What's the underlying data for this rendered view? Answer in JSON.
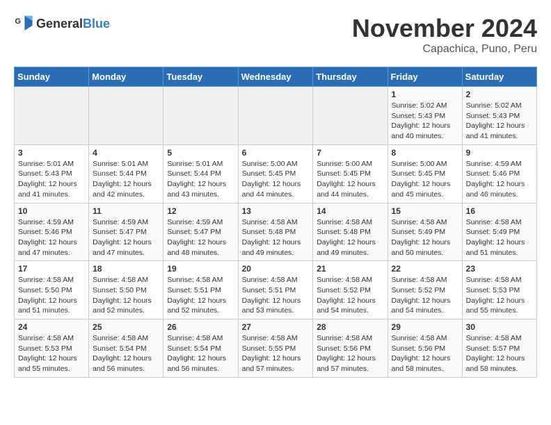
{
  "header": {
    "logo_general": "General",
    "logo_blue": "Blue",
    "month_title": "November 2024",
    "location": "Capachica, Puno, Peru"
  },
  "days_of_week": [
    "Sunday",
    "Monday",
    "Tuesday",
    "Wednesday",
    "Thursday",
    "Friday",
    "Saturday"
  ],
  "weeks": [
    [
      {
        "day": "",
        "info": ""
      },
      {
        "day": "",
        "info": ""
      },
      {
        "day": "",
        "info": ""
      },
      {
        "day": "",
        "info": ""
      },
      {
        "day": "",
        "info": ""
      },
      {
        "day": "1",
        "info": "Sunrise: 5:02 AM\nSunset: 5:43 PM\nDaylight: 12 hours and 40 minutes."
      },
      {
        "day": "2",
        "info": "Sunrise: 5:02 AM\nSunset: 5:43 PM\nDaylight: 12 hours and 41 minutes."
      }
    ],
    [
      {
        "day": "3",
        "info": "Sunrise: 5:01 AM\nSunset: 5:43 PM\nDaylight: 12 hours and 41 minutes."
      },
      {
        "day": "4",
        "info": "Sunrise: 5:01 AM\nSunset: 5:44 PM\nDaylight: 12 hours and 42 minutes."
      },
      {
        "day": "5",
        "info": "Sunrise: 5:01 AM\nSunset: 5:44 PM\nDaylight: 12 hours and 43 minutes."
      },
      {
        "day": "6",
        "info": "Sunrise: 5:00 AM\nSunset: 5:45 PM\nDaylight: 12 hours and 44 minutes."
      },
      {
        "day": "7",
        "info": "Sunrise: 5:00 AM\nSunset: 5:45 PM\nDaylight: 12 hours and 44 minutes."
      },
      {
        "day": "8",
        "info": "Sunrise: 5:00 AM\nSunset: 5:45 PM\nDaylight: 12 hours and 45 minutes."
      },
      {
        "day": "9",
        "info": "Sunrise: 4:59 AM\nSunset: 5:46 PM\nDaylight: 12 hours and 46 minutes."
      }
    ],
    [
      {
        "day": "10",
        "info": "Sunrise: 4:59 AM\nSunset: 5:46 PM\nDaylight: 12 hours and 47 minutes."
      },
      {
        "day": "11",
        "info": "Sunrise: 4:59 AM\nSunset: 5:47 PM\nDaylight: 12 hours and 47 minutes."
      },
      {
        "day": "12",
        "info": "Sunrise: 4:59 AM\nSunset: 5:47 PM\nDaylight: 12 hours and 48 minutes."
      },
      {
        "day": "13",
        "info": "Sunrise: 4:58 AM\nSunset: 5:48 PM\nDaylight: 12 hours and 49 minutes."
      },
      {
        "day": "14",
        "info": "Sunrise: 4:58 AM\nSunset: 5:48 PM\nDaylight: 12 hours and 49 minutes."
      },
      {
        "day": "15",
        "info": "Sunrise: 4:58 AM\nSunset: 5:49 PM\nDaylight: 12 hours and 50 minutes."
      },
      {
        "day": "16",
        "info": "Sunrise: 4:58 AM\nSunset: 5:49 PM\nDaylight: 12 hours and 51 minutes."
      }
    ],
    [
      {
        "day": "17",
        "info": "Sunrise: 4:58 AM\nSunset: 5:50 PM\nDaylight: 12 hours and 51 minutes."
      },
      {
        "day": "18",
        "info": "Sunrise: 4:58 AM\nSunset: 5:50 PM\nDaylight: 12 hours and 52 minutes."
      },
      {
        "day": "19",
        "info": "Sunrise: 4:58 AM\nSunset: 5:51 PM\nDaylight: 12 hours and 52 minutes."
      },
      {
        "day": "20",
        "info": "Sunrise: 4:58 AM\nSunset: 5:51 PM\nDaylight: 12 hours and 53 minutes."
      },
      {
        "day": "21",
        "info": "Sunrise: 4:58 AM\nSunset: 5:52 PM\nDaylight: 12 hours and 54 minutes."
      },
      {
        "day": "22",
        "info": "Sunrise: 4:58 AM\nSunset: 5:52 PM\nDaylight: 12 hours and 54 minutes."
      },
      {
        "day": "23",
        "info": "Sunrise: 4:58 AM\nSunset: 5:53 PM\nDaylight: 12 hours and 55 minutes."
      }
    ],
    [
      {
        "day": "24",
        "info": "Sunrise: 4:58 AM\nSunset: 5:53 PM\nDaylight: 12 hours and 55 minutes."
      },
      {
        "day": "25",
        "info": "Sunrise: 4:58 AM\nSunset: 5:54 PM\nDaylight: 12 hours and 56 minutes."
      },
      {
        "day": "26",
        "info": "Sunrise: 4:58 AM\nSunset: 5:54 PM\nDaylight: 12 hours and 56 minutes."
      },
      {
        "day": "27",
        "info": "Sunrise: 4:58 AM\nSunset: 5:55 PM\nDaylight: 12 hours and 57 minutes."
      },
      {
        "day": "28",
        "info": "Sunrise: 4:58 AM\nSunset: 5:56 PM\nDaylight: 12 hours and 57 minutes."
      },
      {
        "day": "29",
        "info": "Sunrise: 4:58 AM\nSunset: 5:56 PM\nDaylight: 12 hours and 58 minutes."
      },
      {
        "day": "30",
        "info": "Sunrise: 4:58 AM\nSunset: 5:57 PM\nDaylight: 12 hours and 58 minutes."
      }
    ]
  ]
}
